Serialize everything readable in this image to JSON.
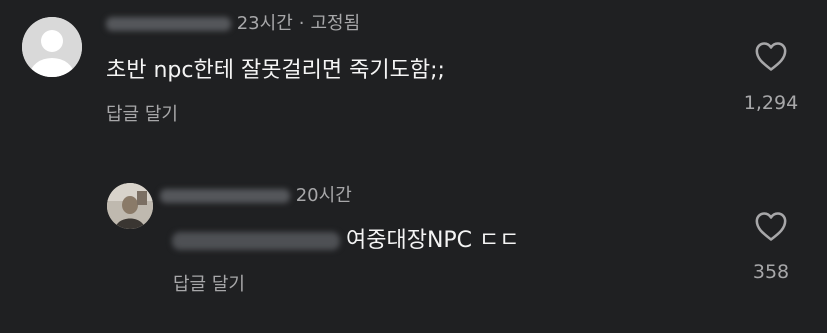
{
  "comments": [
    {
      "time": "23시간",
      "separator": "·",
      "pinned_label": "고정됨",
      "text": "초반 npc한테 잘못걸리면 죽기도함;;",
      "reply_label": "답글 달기",
      "likes": "1,294",
      "icons": {
        "avatar": "default-avatar-icon",
        "like": "heart-outline-icon"
      }
    }
  ],
  "replies": [
    {
      "time": "20시간",
      "text": "여중대장NPC ㄷㄷ",
      "reply_label": "답글 달기",
      "likes": "358",
      "icons": {
        "avatar": "user-photo-avatar",
        "like": "heart-outline-icon"
      }
    }
  ],
  "colors": {
    "background": "#1f2022",
    "primary_text": "#f4f4f4",
    "secondary_text": "#a7a7a9"
  }
}
